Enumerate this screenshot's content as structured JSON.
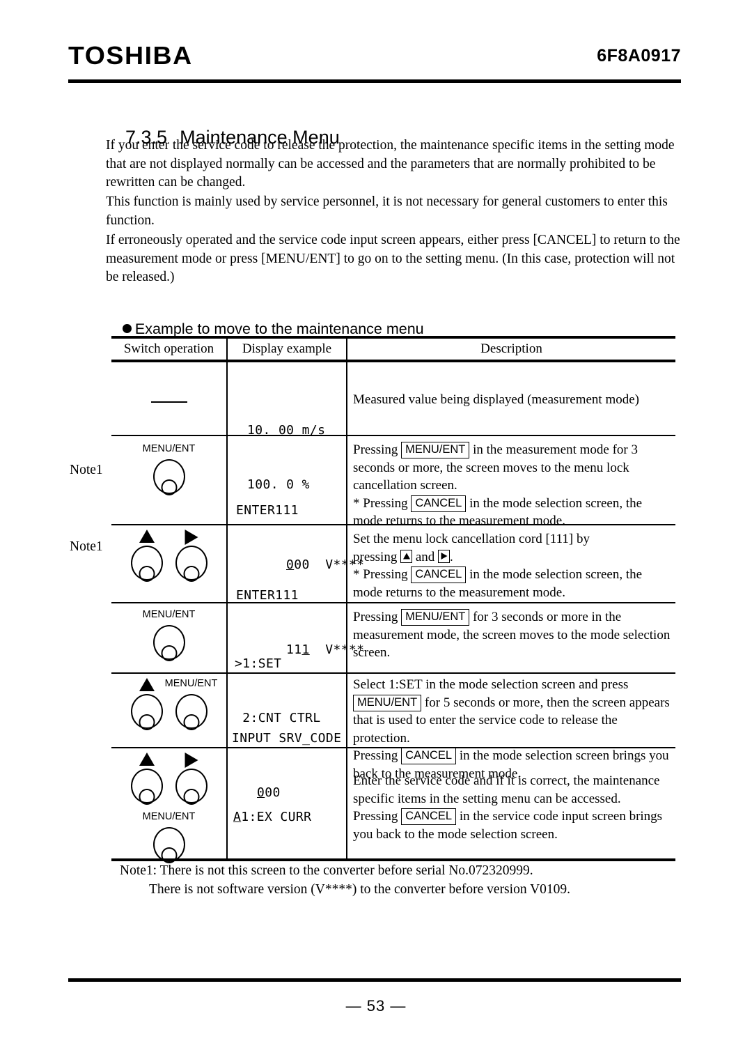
{
  "header": {
    "brand": "TOSHIBA",
    "doc_code": "6F8A0917"
  },
  "section": {
    "number": "7.3.5",
    "title": "Maintenance Menu"
  },
  "paragraphs": [
    "If you enter the service code to release the protection, the maintenance specific items in the setting mode that are not displayed normally can be accessed and the parameters that are normally prohibited to be rewritten can be changed.",
    "This function is mainly used by service personnel, it is not necessary for general customers to enter this function.",
    "If erroneously operated and the service code input screen appears, either press [CANCEL] to return to the measurement mode or press [MENU/ENT] to go on to the setting menu. (In this case, protection will not be released.)"
  ],
  "bullet_heading": "Example to move to the maintenance menu",
  "table": {
    "headers": [
      "Switch operation",
      "Display example",
      "Description"
    ],
    "rows": [
      {
        "note": "",
        "buttons": [],
        "switch_mark": "dash",
        "display": [
          "10. 00 m/s",
          "100. 0 %"
        ],
        "description_lines": [
          "Measured value being displayed (measurement mode)"
        ]
      },
      {
        "note": "Note1",
        "buttons": [
          {
            "caption": "MENU/ENT",
            "arrow": ""
          }
        ],
        "switch_mark": "",
        "display": [
          "ENTER111",
          "000  V****"
        ],
        "display_underline": "first-of-second-line",
        "description_lines": [
          "Pressing [MENU/ENT] in the measurement mode for 3 seconds",
          "or more, the screen moves to the menu lock cancellation",
          "screen.",
          "* Pressing [CANCEL] in the mode selection screen, the mode",
          "returns to the measurement mode."
        ]
      },
      {
        "note": "Note1",
        "buttons": [
          {
            "caption": "",
            "arrow": "up"
          },
          {
            "caption": "",
            "arrow": "right"
          }
        ],
        "switch_mark": "",
        "display": [
          "ENTER111",
          "111  V****"
        ],
        "display_underline": "last-of-second-line",
        "description_lines": [
          "Set the menu lock cancellation cord [111] by",
          "pressing [UP] and [RIGHT] .",
          "* Pressing [CANCEL] in the mode selection screen, the mode",
          "returns to the measurement mode."
        ]
      },
      {
        "note": "",
        "buttons": [
          {
            "caption": "MENU/ENT",
            "arrow": ""
          }
        ],
        "switch_mark": "",
        "display": [
          ">1:SET",
          " 2:CNT CTRL"
        ],
        "description_lines": [
          "Pressing [MENU/ENT] for 3 seconds or more in the",
          "measurement mode, the screen moves to the mode selection",
          "screen."
        ]
      },
      {
        "note": "",
        "buttons": [
          {
            "caption": "",
            "arrow": "up"
          },
          {
            "caption": "MENU/ENT",
            "arrow": ""
          }
        ],
        "switch_mark": "",
        "display": [
          "INPUT SRV_CODE",
          "000"
        ],
        "description_lines": [
          "Select 1:SET in the mode selection screen and press",
          "[MENU/ENT] for 5 seconds or more, then the screen appears",
          "that is used to enter the service code to release the protection.",
          "Pressing [CANCEL] in the mode selection screen brings you",
          "back to the measurement mode."
        ]
      },
      {
        "note": "",
        "buttons": [
          {
            "caption": "",
            "arrow": "up"
          },
          {
            "caption": "",
            "arrow": "right"
          },
          {
            "caption": "MENU/ENT",
            "arrow": ""
          }
        ],
        "switch_mark": "",
        "display": [
          "A1:EX CURR"
        ],
        "description_lines": [
          "Enter the service code and if it is correct, the maintenance",
          "specific items in the setting menu can be accessed.",
          "Pressing [CANCEL] in the service code input screen brings you",
          "back to the mode selection screen."
        ]
      }
    ]
  },
  "chips": {
    "menu_ent": "MENU/ENT",
    "cancel": "CANCEL"
  },
  "display_cells": {
    "r1l1": "10. 00 m/s",
    "r1l2": "100. 0 %",
    "r2l1": "ENTER111",
    "r2l2_a": "0",
    "r2l2_b": "00",
    "r2l2_c": "V****",
    "r3l1": "ENTER111",
    "r3l2_a": "11",
    "r3l2_b": "1",
    "r3l2_c": "V****",
    "r4l1": ">1:SET",
    "r4l2": " 2:CNT CTRL",
    "r5l1": "INPUT SRV_CODE",
    "r5l2_a": "0",
    "r5l2_b": "00",
    "r6l1_a": "A",
    "r6l1_b": "1:EX CURR"
  },
  "descriptions": {
    "r1": "Measured value being displayed (measurement mode)",
    "r2a_pre": "Pressing",
    "r2a_post": "in the measurement mode for 3 seconds or more, the screen moves to the menu lock cancellation screen.",
    "r2b_pre": "* Pressing",
    "r2b_post": "in the mode selection screen, the mode returns to the measurement mode.",
    "r3a_l1": "Set the menu lock cancellation cord [111] by",
    "r3a_l2_pre": "pressing",
    "r3a_and": "and",
    "r3a_end": ".",
    "r3b_pre": "* Pressing",
    "r3b_post": "in the mode selection screen, the mode returns to the measurement mode.",
    "r4_pre": "Pressing",
    "r4_post": "for 3 seconds or more in the measurement mode, the screen moves to the mode selection screen.",
    "r5a_l1": "Select 1:SET in the mode selection screen and press",
    "r5a_post": "for 5 seconds or more, then the screen appears that is used to enter the service code to release the protection.",
    "r5b_pre": "Pressing",
    "r5b_post": "in the mode selection screen brings you back to the measurement mode.",
    "r6a": "Enter the service code and if it is correct, the maintenance specific items in the setting menu can be accessed.",
    "r6b_pre": "Pressing",
    "r6b_post": "in the service code input screen brings you back to the mode selection screen."
  },
  "button_captions": {
    "menu_ent": "MENU/ENT"
  },
  "note_labels": {
    "n1": "Note1",
    "n2": "Note1"
  },
  "footnotes": {
    "line1": "Note1: There is not this screen to the converter before serial No.072320999.",
    "line2": "There is not software version (V****) to the converter before version V0109."
  },
  "footer": {
    "page_number": "— 53 —"
  }
}
